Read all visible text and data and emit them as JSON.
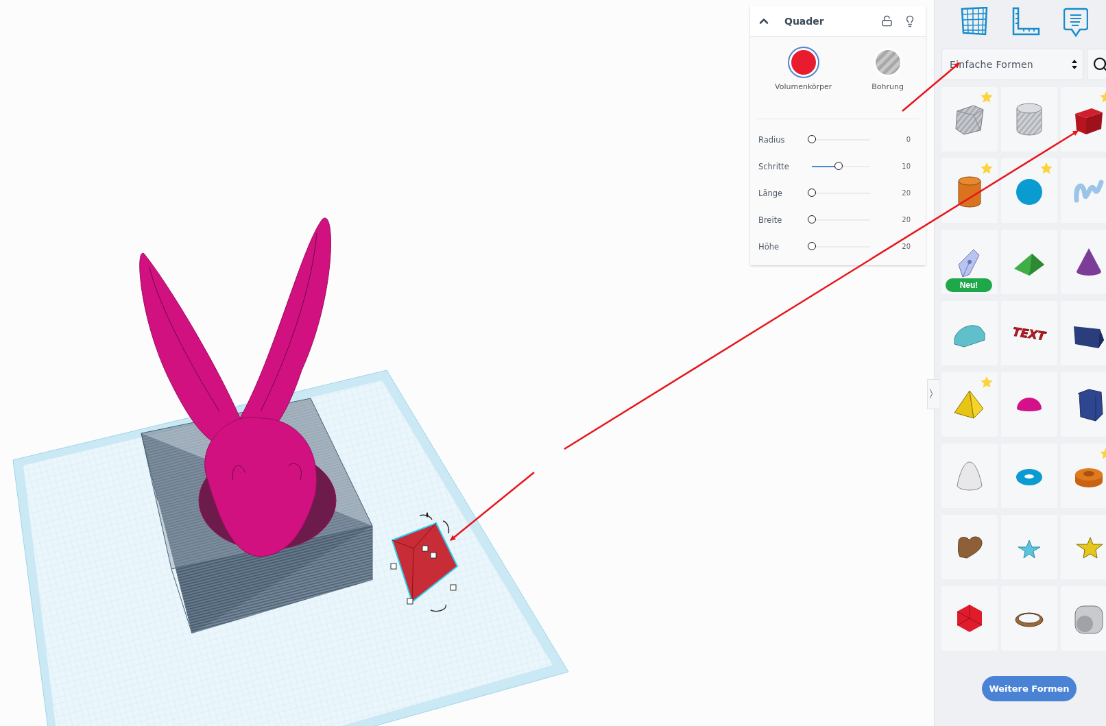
{
  "inspector": {
    "title": "Quader",
    "expanded": true,
    "locked": false,
    "materials": [
      {
        "kind": "solid",
        "label": "Volumenkörper",
        "selected": true
      },
      {
        "kind": "hole",
        "label": "Bohrung",
        "selected": false
      }
    ],
    "sliders": [
      {
        "label": "Radius",
        "level": 0,
        "value": "0"
      },
      {
        "label": "Schritte",
        "level": 0.46,
        "value": "10"
      },
      {
        "label": "Länge",
        "level": 0,
        "value": "20"
      },
      {
        "label": "Breite",
        "level": 0,
        "value": "20"
      },
      {
        "label": "Höhe",
        "level": 0,
        "value": "20"
      }
    ]
  },
  "collapse_toggle": "〉",
  "sidebar": {
    "category": "Einfache Formen",
    "more_button": "Weitere Formen",
    "shapes": [
      {
        "kind": "box-hole",
        "starred": true
      },
      {
        "kind": "cylinder-hole",
        "starred": false
      },
      {
        "kind": "box",
        "starred": true
      },
      {
        "kind": "cylinder",
        "starred": true
      },
      {
        "kind": "sphere",
        "starred": true
      },
      {
        "kind": "scribble",
        "starred": false
      },
      {
        "kind": "sketch",
        "starred": false,
        "badge": "Neu!"
      },
      {
        "kind": "roof",
        "starred": false
      },
      {
        "kind": "cone",
        "starred": false
      },
      {
        "kind": "round-roof",
        "starred": false
      },
      {
        "kind": "text",
        "starred": false,
        "art_text": "TEXT"
      },
      {
        "kind": "prism",
        "starred": false
      },
      {
        "kind": "pyramid",
        "starred": true
      },
      {
        "kind": "half-sphere",
        "starred": false
      },
      {
        "kind": "polygon",
        "starred": false
      },
      {
        "kind": "paraboloid",
        "starred": false
      },
      {
        "kind": "torus",
        "starred": false
      },
      {
        "kind": "tube",
        "starred": true
      },
      {
        "kind": "heart",
        "starred": false
      },
      {
        "kind": "star",
        "starred": false
      },
      {
        "kind": "star-extruded",
        "starred": false
      },
      {
        "kind": "icosahedron",
        "starred": false
      },
      {
        "kind": "ring",
        "starred": false
      },
      {
        "kind": "rounded-cube",
        "starred": false
      }
    ]
  }
}
